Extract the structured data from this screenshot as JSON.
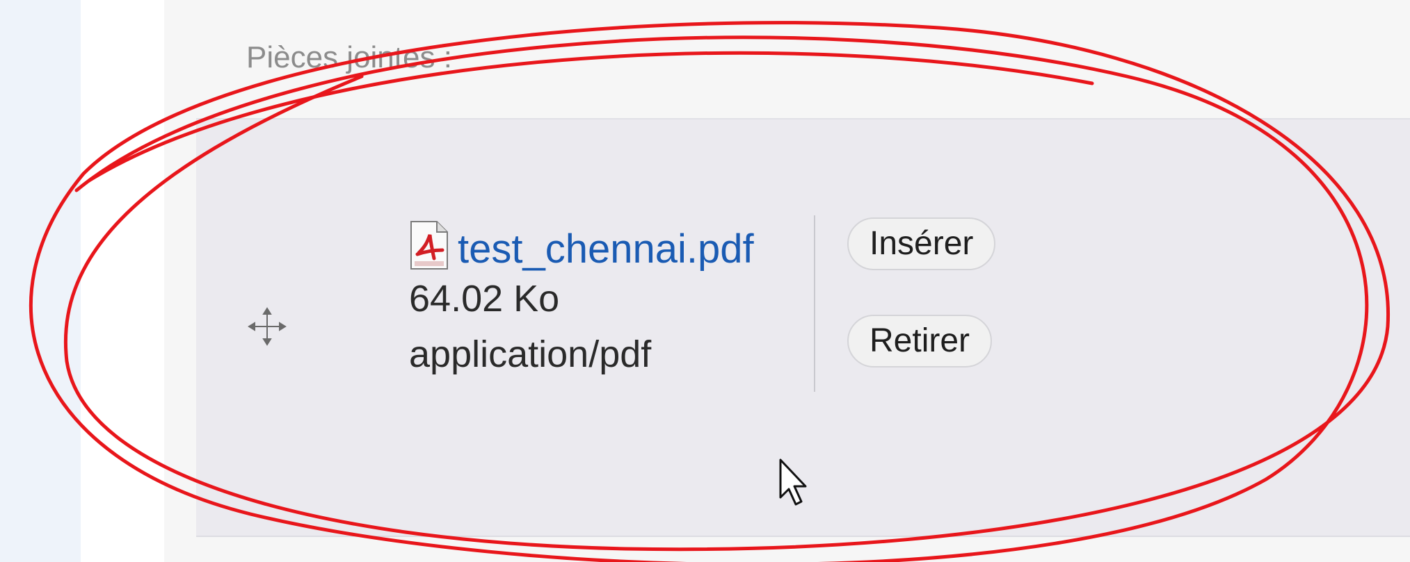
{
  "attachments": {
    "section_label": "Pièces jointes :",
    "items": [
      {
        "file_name": "test_chennai.pdf",
        "file_size": "64.02 Ko",
        "mime_type": "application/pdf",
        "icon": "pdf-file-icon",
        "drag_icon": "move-arrows-icon",
        "actions": {
          "insert_label": "Insérer",
          "remove_label": "Retirer"
        }
      }
    ]
  },
  "colors": {
    "link": "#1a5bb3",
    "panel_background": "#ebeaef",
    "annotation_red": "#e8161b",
    "label_gray": "#8c8c8c"
  },
  "cursor": "arrow-pointer-icon"
}
